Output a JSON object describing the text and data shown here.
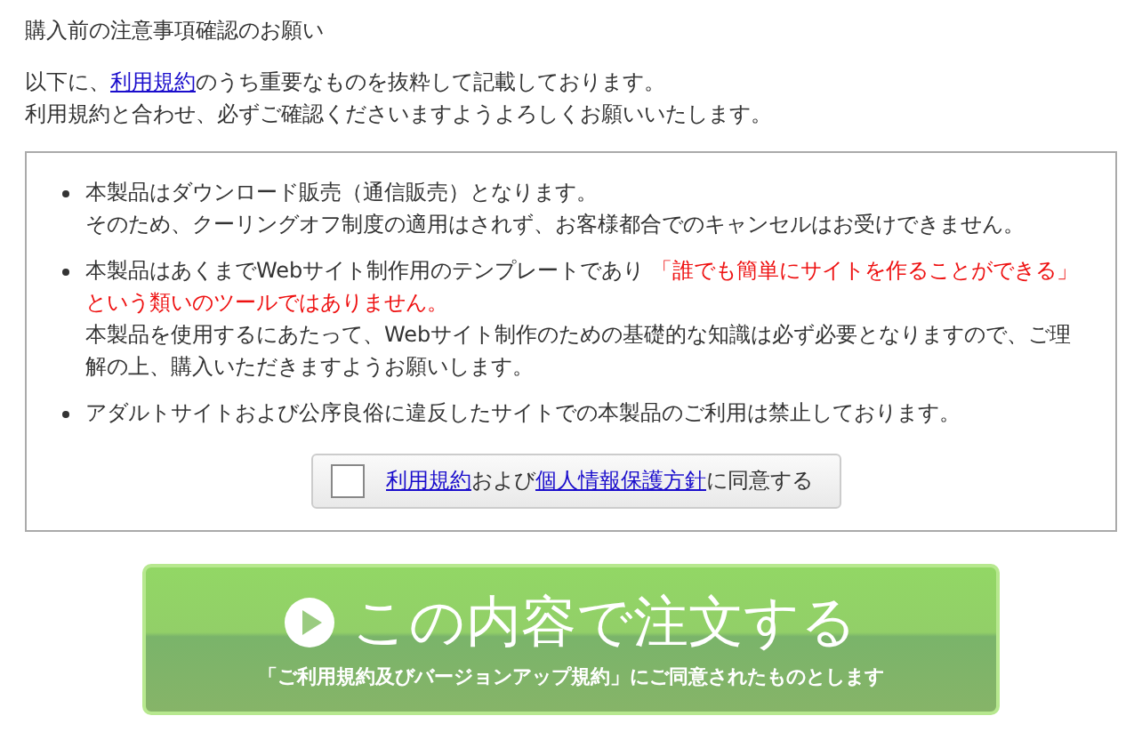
{
  "heading": "購入前の注意事項確認のお願い",
  "intro": [
    [
      {
        "kind": "text",
        "text": "以下に、"
      },
      {
        "kind": "link",
        "text": "利用規約"
      },
      {
        "kind": "text",
        "text": "のうち重要なものを抜粋して記載しております。"
      }
    ],
    [
      {
        "kind": "text",
        "text": "利用規約と合わせ、必ずご確認くださいますようよろしくお願いいたします。"
      }
    ]
  ],
  "notices": [
    {
      "paragraphs": [
        [
          {
            "kind": "text",
            "text": "本製品はダウンロード販売（通信販売）となります。"
          }
        ],
        [
          {
            "kind": "text",
            "text": "そのため、クーリングオフ制度の適用はされず、お客様都合でのキャンセルはお受けできません。"
          }
        ]
      ]
    },
    {
      "paragraphs": [
        [
          {
            "kind": "text",
            "text": "本製品はあくまでWebサイト制作用のテンプレートであり "
          },
          {
            "kind": "warning",
            "text": "「誰でも簡単にサイトを作ることができる」という類いのツールではありません。"
          }
        ],
        [
          {
            "kind": "text",
            "text": "本製品を使用するにあたって、Webサイト制作のための基礎的な知識は必ず必要となりますので、ご理解の上、購入いただきますようお願いします。"
          }
        ]
      ]
    },
    {
      "paragraphs": [
        [
          {
            "kind": "text",
            "text": "アダルトサイトおよび公序良俗に違反したサイトでの本製品のご利用は禁止しております。"
          }
        ]
      ]
    }
  ],
  "agreement": {
    "checked": false,
    "parts": [
      {
        "kind": "link",
        "text": "利用規約"
      },
      {
        "kind": "text",
        "text": "および"
      },
      {
        "kind": "link",
        "text": "個人情報保護方針"
      },
      {
        "kind": "text",
        "text": "に同意する"
      }
    ]
  },
  "order_button": {
    "label": "この内容で注文する",
    "note": "「ご利用規約及びバージョンアップ規約」にご同意されたものとします"
  }
}
